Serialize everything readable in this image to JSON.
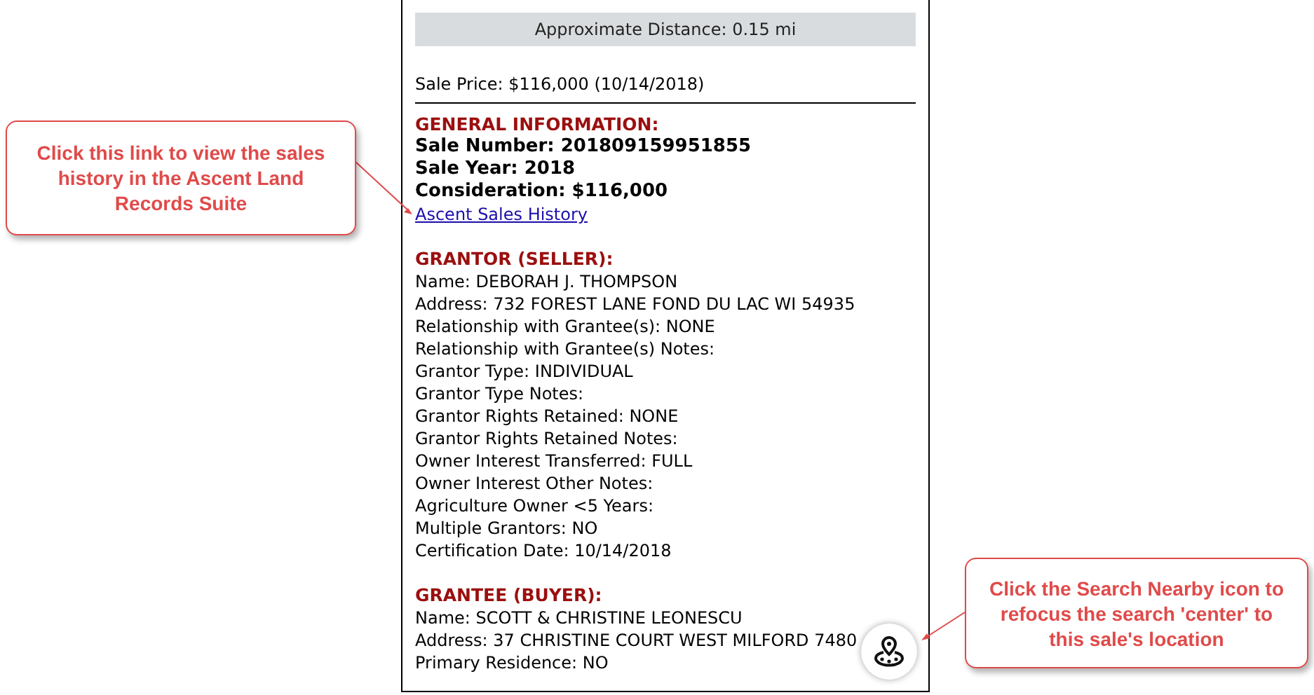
{
  "distance_bar": "Approximate Distance: 0.15 mi",
  "sale_price": "Sale Price: $116,000 (10/14/2018)",
  "sections": [
    {
      "heading": "GENERAL INFORMATION:",
      "lines": [
        {
          "kind": "bold",
          "text": "Sale Number: 201809159951855"
        },
        {
          "kind": "bold",
          "text": "Sale Year: 2018"
        },
        {
          "kind": "bold",
          "text": "Consideration: $116,000"
        },
        {
          "kind": "link",
          "text": "Ascent Sales History"
        }
      ]
    },
    {
      "heading": "GRANTOR (SELLER):",
      "lines": [
        {
          "kind": "plain",
          "text": "Name: DEBORAH J. THOMPSON"
        },
        {
          "kind": "plain",
          "text": "Address: 732 FOREST LANE FOND DU LAC WI 54935"
        },
        {
          "kind": "plain",
          "text": "Relationship with Grantee(s): NONE"
        },
        {
          "kind": "plain",
          "text": "Relationship with Grantee(s) Notes:"
        },
        {
          "kind": "plain",
          "text": "Grantor Type: INDIVIDUAL"
        },
        {
          "kind": "plain",
          "text": "Grantor Type Notes:"
        },
        {
          "kind": "plain",
          "text": "Grantor Rights Retained: NONE"
        },
        {
          "kind": "plain",
          "text": "Grantor Rights Retained Notes:"
        },
        {
          "kind": "plain",
          "text": "Owner Interest Transferred: FULL"
        },
        {
          "kind": "plain",
          "text": "Owner Interest Other Notes:"
        },
        {
          "kind": "plain",
          "text": "Agriculture Owner <5 Years:"
        },
        {
          "kind": "plain",
          "text": "Multiple Grantors: NO"
        },
        {
          "kind": "plain",
          "text": "Certification Date: 10/14/2018"
        }
      ]
    },
    {
      "heading": "GRANTEE (BUYER):",
      "lines": [
        {
          "kind": "plain",
          "text": "Name: SCOTT & CHRISTINE LEONESCU"
        },
        {
          "kind": "plain",
          "text": "Address: 37 CHRISTINE COURT WEST MILFORD 7480"
        },
        {
          "kind": "plain",
          "text": "Primary Residence: NO"
        }
      ]
    }
  ],
  "callouts": [
    {
      "kind": "link_hint",
      "text": "Click this link to view the sales history in the Ascent Land Records Suite"
    },
    {
      "kind": "icon_hint",
      "text": "Click the Search Nearby icon to refocus the search 'center' to this sale's location"
    }
  ]
}
